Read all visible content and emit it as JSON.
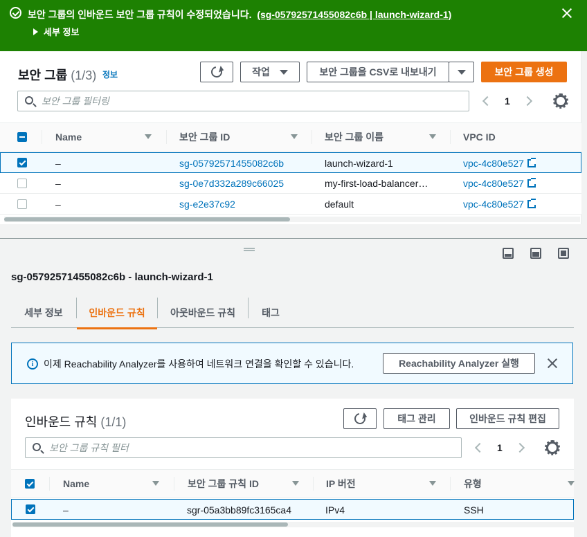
{
  "flash": {
    "message": "보안 그룹의 인바운드 보안 그룹 규칙이 수정되었습니다.",
    "link": "(sg-05792571455082c6b | launch-wizard-1)",
    "details_label": "세부 정보"
  },
  "sg_panel": {
    "title": "보안 그룹",
    "count": "(1/3)",
    "info_link": "정보",
    "actions_label": "작업",
    "export_label": "보안 그룹을 CSV로 내보내기",
    "create_label": "보안 그룹 생성",
    "search_placeholder": "보안 그룹 필터링",
    "page": "1",
    "columns": [
      "Name",
      "보안 그룹 ID",
      "보안 그룹 이름",
      "VPC ID"
    ],
    "rows": [
      {
        "name": "–",
        "id": "sg-05792571455082c6b",
        "group_name": "launch-wizard-1",
        "vpc": "vpc-4c80e527",
        "selected": true
      },
      {
        "name": "–",
        "id": "sg-0e7d332a289c66025",
        "group_name": "my-first-load-balancer…",
        "vpc": "vpc-4c80e527",
        "selected": false
      },
      {
        "name": "–",
        "id": "sg-e2e37c92",
        "group_name": "default",
        "vpc": "vpc-4c80e527",
        "selected": false
      }
    ]
  },
  "detail": {
    "title": "sg-05792571455082c6b - launch-wizard-1",
    "tabs": [
      "세부 정보",
      "인바운드 규칙",
      "아웃바운드 규칙",
      "태그"
    ],
    "active_tab": 1,
    "info_text": "이제 Reachability Analyzer를 사용하여 네트워크 연결을 확인할 수 있습니다.",
    "info_button": "Reachability Analyzer 실행"
  },
  "inbound": {
    "title": "인바운드 규칙",
    "count": "(1/1)",
    "manage_tags_label": "태그 관리",
    "edit_label": "인바운드 규칙 편집",
    "search_placeholder": "보안 그룹 규칙 필터",
    "page": "1",
    "columns": [
      "Name",
      "보안 그룹 규칙 ID",
      "IP 버전",
      "유형"
    ],
    "rows": [
      {
        "name": "–",
        "rule_id": "sgr-05a3bb89fc3165ca4",
        "ip_version": "IPv4",
        "type": "SSH",
        "selected": true
      }
    ]
  },
  "colors": {
    "success": "#1d8102",
    "primary": "#ec7211",
    "link": "#0073bb"
  }
}
